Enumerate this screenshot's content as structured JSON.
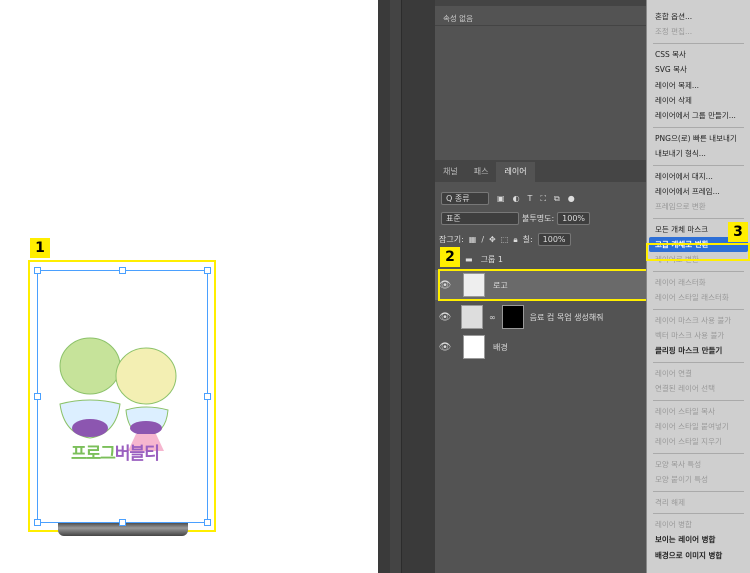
{
  "canvas": {
    "brand_text_green": "프로그",
    "brand_text_purple": "버블티",
    "badge": "1"
  },
  "properties": {
    "empty_label": "속성 없음"
  },
  "layers_panel": {
    "tabs": [
      {
        "label": "채널"
      },
      {
        "label": "패스"
      },
      {
        "label": "레이어"
      }
    ],
    "filter_label": "Q 종류",
    "blend_mode": "표준",
    "opacity_label": "불투명도:",
    "opacity_value": "100%",
    "lock_label": "잠그기:",
    "fill_label": "칠:",
    "fill_value": "100%",
    "badge": "2",
    "layers": [
      {
        "name": "그룹 1"
      },
      {
        "name": "로고"
      },
      {
        "name": "음료 컵 목업 생성해줘"
      },
      {
        "name": "배경"
      }
    ]
  },
  "context_menu": {
    "badge": "3",
    "items": [
      {
        "label": "혼합 옵션...",
        "state": "normal"
      },
      {
        "label": "조정 편집...",
        "state": "dis"
      },
      {
        "sep": true
      },
      {
        "label": "CSS 복사",
        "state": "normal"
      },
      {
        "label": "SVG 복사",
        "state": "normal"
      },
      {
        "label": "레이어 복제...",
        "state": "normal"
      },
      {
        "label": "레이어 삭제",
        "state": "normal"
      },
      {
        "label": "레이어에서 그룹 만들기...",
        "state": "normal"
      },
      {
        "sep": true
      },
      {
        "label": "PNG으(로) 빠른 내보내기",
        "state": "normal"
      },
      {
        "label": "내보내기 형식...",
        "state": "normal"
      },
      {
        "sep": true
      },
      {
        "label": "레이어에서 대지...",
        "state": "normal"
      },
      {
        "label": "레이어에서 프레임...",
        "state": "normal"
      },
      {
        "label": "프레임으로 변환",
        "state": "dis"
      },
      {
        "sep": true
      },
      {
        "label": "모든 개체 마스크",
        "state": "normal"
      },
      {
        "label": "고급 개체로 변환",
        "state": "hl"
      },
      {
        "label": "레이어로 변환",
        "state": "dis"
      },
      {
        "sep": true
      },
      {
        "label": "레이어 래스터화",
        "state": "dis"
      },
      {
        "label": "레이어 스타일 래스터화",
        "state": "dis"
      },
      {
        "sep": true
      },
      {
        "label": "레이어 마스크 사용 불가",
        "state": "dis"
      },
      {
        "label": "벡터 마스크 사용 불가",
        "state": "dis"
      },
      {
        "label": "클리핑 마스크 만들기",
        "state": "bold"
      },
      {
        "sep": true
      },
      {
        "label": "레이어 연결",
        "state": "dis"
      },
      {
        "label": "연결된 레이어 선택",
        "state": "dis"
      },
      {
        "sep": true
      },
      {
        "label": "레이어 스타일 복사",
        "state": "dis"
      },
      {
        "label": "레이어 스타일 붙여넣기",
        "state": "dis"
      },
      {
        "label": "레이어 스타일 지우기",
        "state": "dis"
      },
      {
        "sep": true
      },
      {
        "label": "모양 복사 특성",
        "state": "dis"
      },
      {
        "label": "모양 붙이기 특성",
        "state": "dis"
      },
      {
        "sep": true
      },
      {
        "label": "격리 해제",
        "state": "dis"
      },
      {
        "sep": true
      },
      {
        "label": "레이어 병합",
        "state": "dis"
      },
      {
        "label": "보이는 레이어 병합",
        "state": "bold"
      },
      {
        "label": "배경으로 이미지 병합",
        "state": "bold"
      }
    ]
  }
}
